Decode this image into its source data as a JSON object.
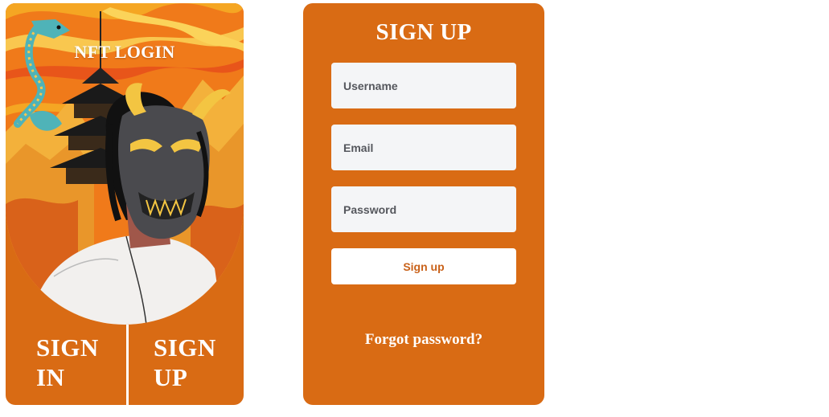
{
  "brand": {
    "title": "NFT LOGIN",
    "illustration_icon": "oni-mask-samurai-illustration-icon"
  },
  "nav": {
    "sign_in_label": "SIGN IN",
    "sign_up_label": "SIGN UP"
  },
  "form": {
    "title": "SIGN UP",
    "username_placeholder": "Username",
    "email_placeholder": "Email",
    "password_placeholder": "Password",
    "submit_label": "Sign up",
    "forgot_label": "Forgot password?"
  },
  "colors": {
    "card_orange": "#d96b14",
    "field_bg": "#f4f5f7",
    "button_text": "#c9621a",
    "white": "#ffffff"
  }
}
